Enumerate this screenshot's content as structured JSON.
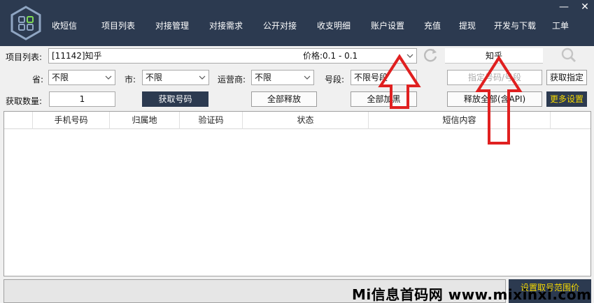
{
  "nav": {
    "items": [
      "收短信",
      "项目列表",
      "对接管理",
      "对接需求",
      "公开对接",
      "收支明细",
      "账户设置",
      "充值",
      "提现",
      "开发与下载",
      "工单"
    ],
    "minimize": "—",
    "close": "✕"
  },
  "project": {
    "label": "项目列表:",
    "value": "[11142]知乎",
    "price": "价格:0.1 - 0.1",
    "search_value": "知乎"
  },
  "filters": {
    "province_label": "省:",
    "province_value": "不限",
    "city_label": "市:",
    "city_value": "不限",
    "carrier_label": "运营商:",
    "carrier_value": "不限",
    "segment_label": "号段:",
    "segment_value": "不限号段",
    "specify_placeholder": "指定号码/号段",
    "get_specified_label": "获取指定"
  },
  "actions": {
    "quantity_label": "获取数量:",
    "quantity_value": "1",
    "get_number": "获取号码",
    "release_all": "全部释放",
    "blacklist_all": "全部加黑",
    "release_all_api": "释放全部(含API)",
    "more_settings": "更多设置"
  },
  "table": {
    "columns": [
      "手机号码",
      "归属地",
      "验证码",
      "状态",
      "短信内容"
    ]
  },
  "bottom": {
    "range_button": "设置取号范围价",
    "watermark": "Mi信息首码网 www.mixinxi.com"
  },
  "colors": {
    "topbar": "#2c3a50",
    "arrow": "#e02020",
    "accent_yellow": "#f5d800"
  }
}
